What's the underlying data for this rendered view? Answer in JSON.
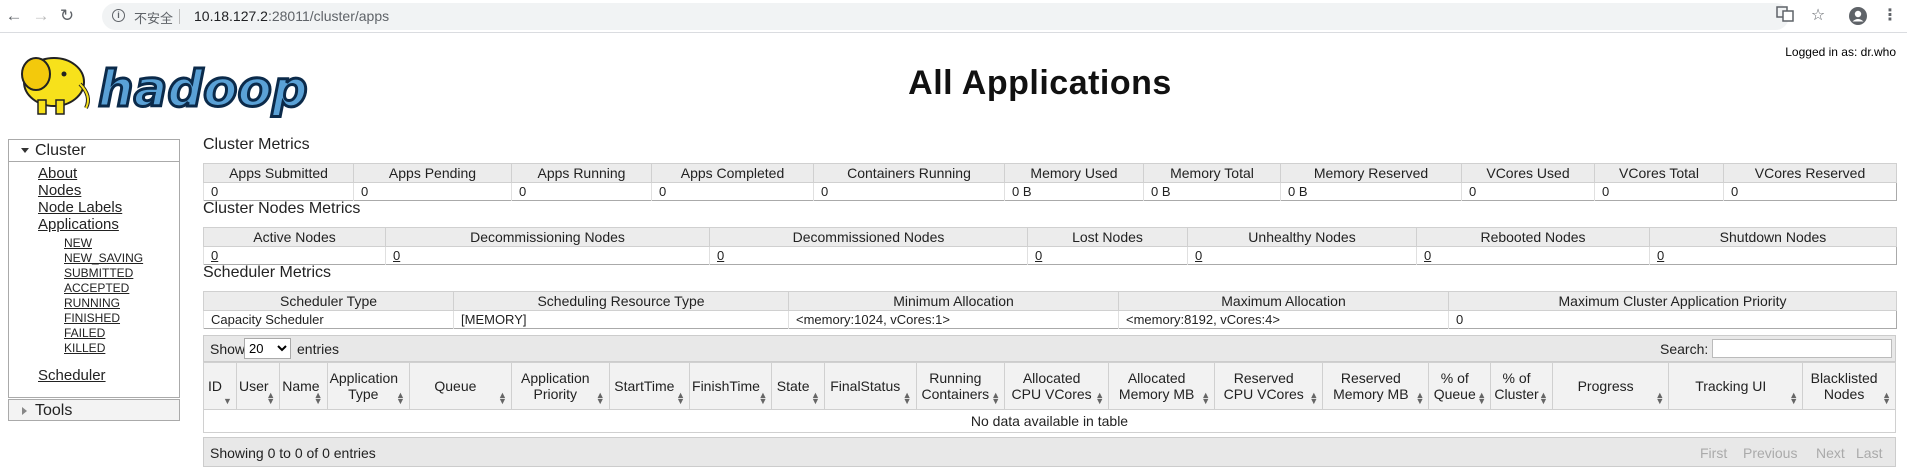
{
  "browser": {
    "insecure_label": "不安全",
    "url_host": "10.18.127.2",
    "url_rest": ":28011/cluster/apps"
  },
  "header": {
    "title": "All Applications",
    "logged_in": "Logged in as: dr.who",
    "logo_text": "hadoop"
  },
  "sidebar": {
    "cluster_label": "Cluster",
    "links": [
      "About",
      "Nodes",
      "Node Labels",
      "Applications"
    ],
    "app_states": [
      "NEW",
      "NEW_SAVING",
      "SUBMITTED",
      "ACCEPTED",
      "RUNNING",
      "FINISHED",
      "FAILED",
      "KILLED"
    ],
    "scheduler": "Scheduler",
    "tools_label": "Tools"
  },
  "cluster_metrics": {
    "title": "Cluster Metrics",
    "headers": [
      "Apps Submitted",
      "Apps Pending",
      "Apps Running",
      "Apps Completed",
      "Containers Running",
      "Memory Used",
      "Memory Total",
      "Memory Reserved",
      "VCores Used",
      "VCores Total",
      "VCores Reserved"
    ],
    "values": [
      "0",
      "0",
      "0",
      "0",
      "0",
      "0 B",
      "0 B",
      "0 B",
      "0",
      "0",
      "0"
    ]
  },
  "node_metrics": {
    "title": "Cluster Nodes Metrics",
    "headers": [
      "Active Nodes",
      "Decommissioning Nodes",
      "Decommissioned Nodes",
      "Lost Nodes",
      "Unhealthy Nodes",
      "Rebooted Nodes",
      "Shutdown Nodes"
    ],
    "values": [
      "0",
      "0",
      "0",
      "0",
      "0",
      "0",
      "0"
    ]
  },
  "scheduler_metrics": {
    "title": "Scheduler Metrics",
    "headers": [
      "Scheduler Type",
      "Scheduling Resource Type",
      "Minimum Allocation",
      "Maximum Allocation",
      "Maximum Cluster Application Priority"
    ],
    "values": [
      "Capacity Scheduler",
      "[MEMORY]",
      "<memory:1024, vCores:1>",
      "<memory:8192, vCores:4>",
      "0"
    ]
  },
  "apps_table": {
    "show_label": "Show",
    "page_size": "20",
    "entries_label": "entries",
    "search_label": "Search:",
    "columns": [
      "ID",
      "User",
      "Name",
      "Application Type",
      "Queue",
      "Application Priority",
      "StartTime",
      "FinishTime",
      "State",
      "FinalStatus",
      "Running Containers",
      "Allocated CPU VCores",
      "Allocated Memory MB",
      "Reserved CPU VCores",
      "Reserved Memory MB",
      "% of Queue",
      "% of Cluster",
      "Progress",
      "Tracking UI",
      "Blacklisted Nodes"
    ],
    "empty_message": "No data available in table",
    "info": "Showing 0 to 0 of 0 entries",
    "pagination": [
      "First",
      "Previous",
      "Next",
      "Last"
    ]
  }
}
